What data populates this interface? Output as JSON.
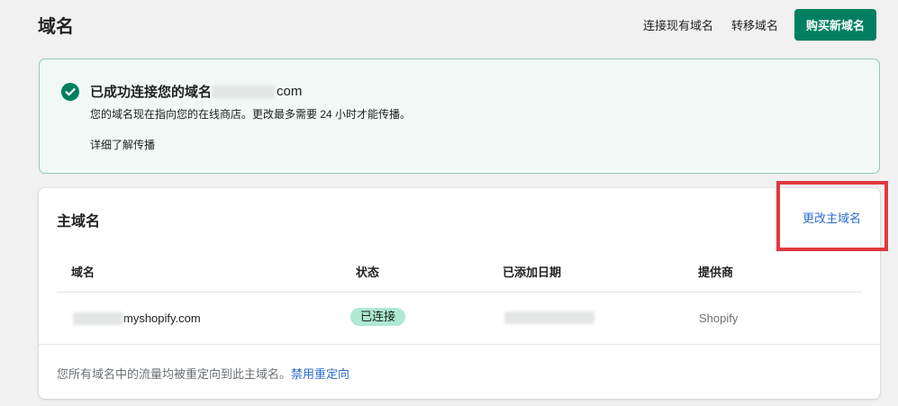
{
  "header": {
    "title": "域名",
    "actions": {
      "connect_existing": "连接现有域名",
      "transfer": "转移域名",
      "buy_new": "购买新域名"
    }
  },
  "banner": {
    "title_prefix": "已成功连接您的域名",
    "domain_suffix": "com",
    "description": "您的域名现在指向您的在线商店。更改最多需要 24 小时才能传播。",
    "learn_more": "详细了解传播"
  },
  "primary_domain": {
    "title": "主域名",
    "change_action": "更改主域名",
    "columns": [
      "域名",
      "状态",
      "已添加日期",
      "提供商"
    ],
    "row": {
      "domain_suffix": "myshopify.com",
      "status": "已连接",
      "provider": "Shopify"
    },
    "footer_text": "您所有域名中的流量均被重定向到此主域名。",
    "footer_link": "禁用重定向"
  },
  "colors": {
    "accent": "#008060",
    "link": "#2c6ecb",
    "success_badge": "#aee9d1",
    "highlight": "#e03a3e"
  }
}
